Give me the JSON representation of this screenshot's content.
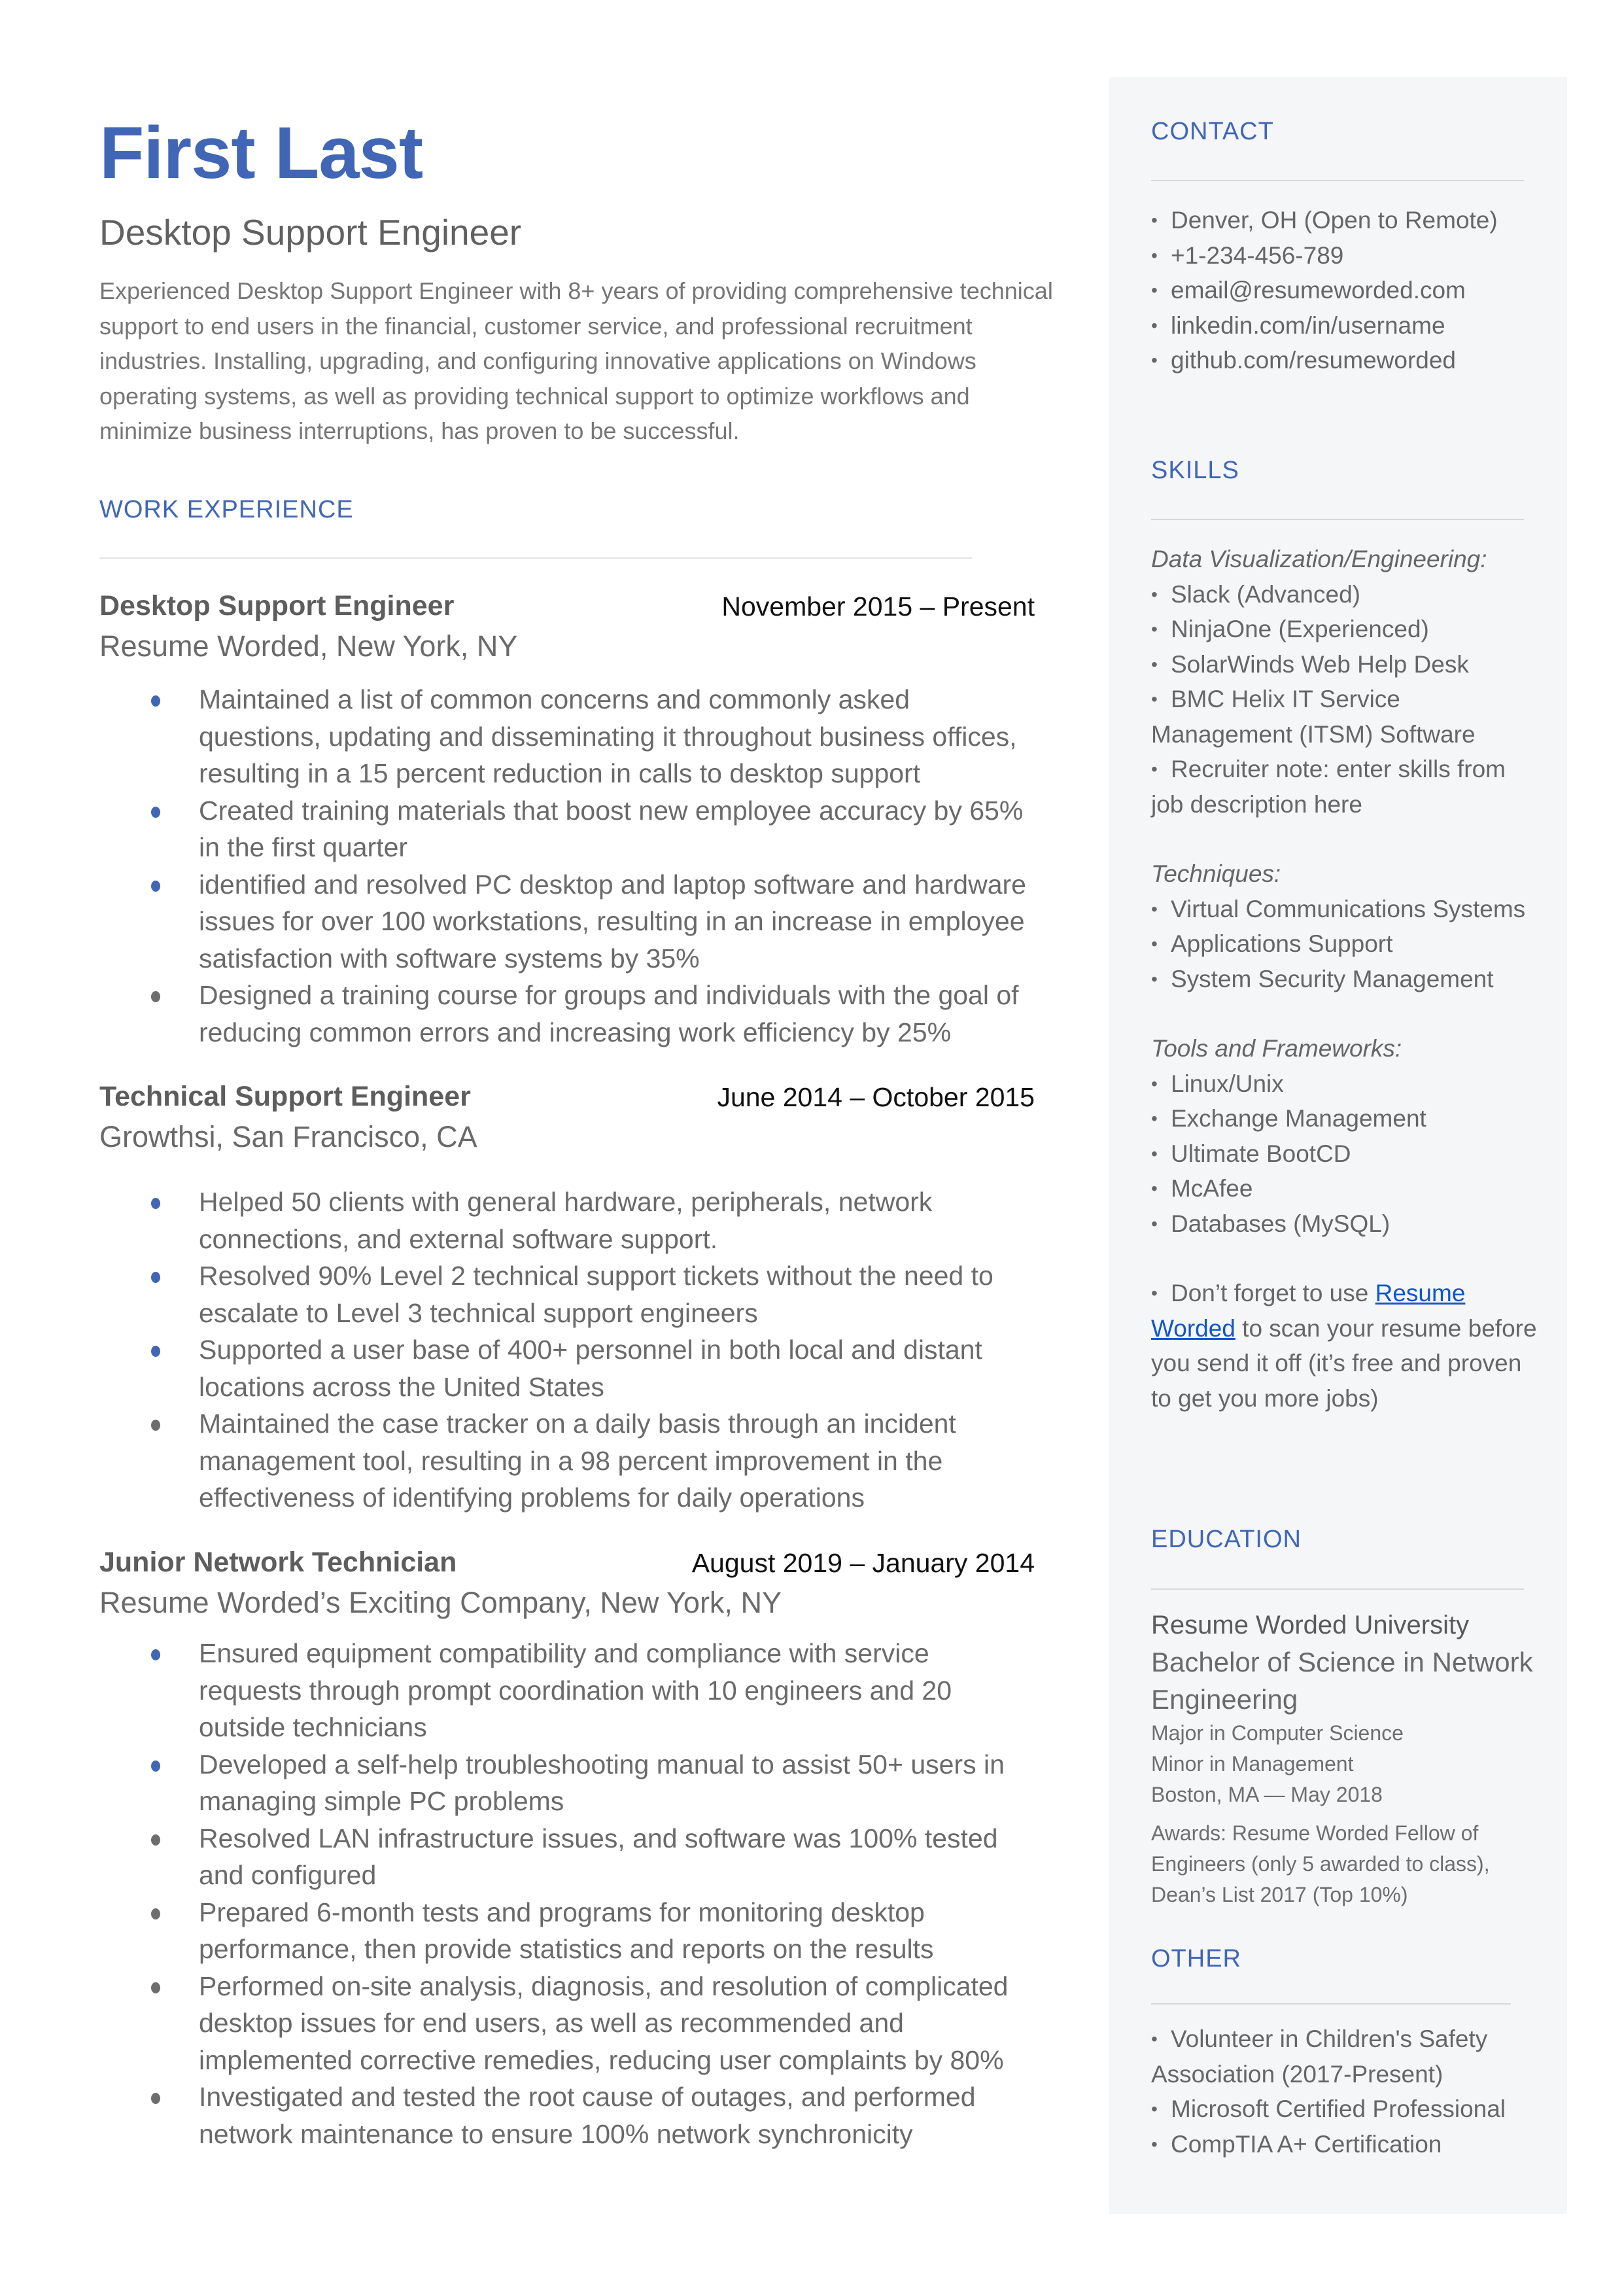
{
  "header": {
    "name": "First Last",
    "role": "Desktop Support Engineer",
    "summary_lines": [
      "Experienced Desktop Support Engineer with 8+ years of providing comprehensive technical",
      "support to end users in the financial, customer service, and professional recruitment",
      "industries. Installing, upgrading, and configuring innovative applications on Windows",
      "operating systems, as well as providing technical support to optimize workflows and",
      "minimize business interruptions, has proven to be successful."
    ]
  },
  "colors": {
    "accent": "#4166b5",
    "sidebar_bg": "#f5f6f8",
    "link": "#1155cc"
  },
  "work": {
    "heading": "WORK EXPERIENCE",
    "jobs": [
      {
        "title": "Desktop Support Engineer",
        "dates": "November 2015 – Present",
        "company": "Resume Worded, New York, NY",
        "bullets": [
          {
            "color": "blue",
            "lines": [
              "Maintained a list of common concerns and commonly asked",
              "questions, updating and disseminating it throughout business offices,",
              "resulting in a 15 percent reduction in calls to desktop support"
            ]
          },
          {
            "color": "blue",
            "lines": [
              "Created training materials that boost new employee accuracy by 65%",
              "in the first quarter"
            ]
          },
          {
            "color": "blue",
            "lines": [
              "identified and resolved PC desktop and laptop software and hardware",
              "issues for over 100 workstations, resulting in an increase in employee",
              "satisfaction with software systems by 35%"
            ]
          },
          {
            "color": "gray",
            "lines": [
              "Designed a training course for groups and individuals with the goal of",
              "reducing common errors and increasing work efficiency by 25%"
            ]
          }
        ]
      },
      {
        "title": "Technical Support Engineer",
        "dates": "June 2014 – October 2015",
        "company": "Growthsi, San Francisco, CA",
        "bullets": [
          {
            "color": "blue",
            "lines": [
              "Helped 50 clients with general hardware, peripherals, network",
              "connections, and external software support."
            ]
          },
          {
            "color": "blue",
            "lines": [
              "Resolved 90% Level 2 technical support tickets without the need to",
              "escalate to Level 3 technical support engineers"
            ]
          },
          {
            "color": "blue",
            "lines": [
              "Supported a user base of 400+ personnel in both local and distant",
              "locations across the United States"
            ]
          },
          {
            "color": "gray",
            "lines": [
              "Maintained the case tracker on a daily basis through an incident",
              "management tool, resulting in a 98 percent improvement in the",
              "effectiveness of identifying problems for daily operations"
            ]
          }
        ]
      },
      {
        "title": "Junior Network Technician",
        "dates": "August 2019 – January 2014",
        "company": "Resume Worded’s Exciting Company, New York, NY",
        "bullets": [
          {
            "color": "blue",
            "lines": [
              "Ensured equipment compatibility and compliance with service",
              "requests through prompt coordination with 10 engineers and 20",
              "outside technicians"
            ]
          },
          {
            "color": "blue",
            "lines": [
              "Developed a self-help troubleshooting manual to assist 50+ users in",
              "managing simple PC problems"
            ]
          },
          {
            "color": "gray",
            "lines": [
              "Resolved LAN infrastructure issues, and software was 100% tested",
              "and configured"
            ]
          },
          {
            "color": "gray",
            "lines": [
              "Prepared 6-month tests and programs for monitoring desktop",
              "performance, then provide statistics and reports on the results"
            ]
          },
          {
            "color": "gray",
            "lines": [
              "Performed on-site analysis, diagnosis, and resolution of complicated",
              "desktop issues for end users, as well as recommended and",
              "implemented corrective remedies, reducing user complaints by 80%"
            ]
          },
          {
            "color": "gray",
            "lines": [
              "Investigated and tested the root cause of outages, and performed",
              "network maintenance to ensure 100% network synchronicity"
            ]
          }
        ]
      }
    ]
  },
  "sidebar": {
    "contact": {
      "heading": "CONTACT",
      "items": [
        "Denver, OH (Open to Remote)",
        "+1-234-456-789",
        "email@resumeworded.com",
        "linkedin.com/in/username",
        "github.com/resumeworded"
      ]
    },
    "skills": {
      "heading": "SKILLS",
      "groups": [
        {
          "category": "Data Visualization/Engineering:",
          "items": [
            "Slack (Advanced)",
            "NinjaOne (Experienced)",
            "SolarWinds Web Help Desk",
            "BMC Helix IT Service Management (ITSM) Software",
            "Recruiter note: enter skills from job description here"
          ]
        },
        {
          "category": "Techniques:",
          "items": [
            "Virtual Communications Systems",
            "Applications Support",
            "System Security Management"
          ]
        },
        {
          "category": "Tools and Frameworks:",
          "items": [
            "Linux/Unix",
            "Exchange Management",
            "Ultimate BootCD",
            "McAfee",
            "Databases (MySQL)"
          ]
        }
      ],
      "tip_prefix": "Don’t forget to use ",
      "tip_link": "Resume Worded",
      "tip_suffix": " to scan your resume before you send it off (it’s free and proven to get you more jobs)"
    },
    "education": {
      "heading": "EDUCATION",
      "school": "Resume Worded University",
      "degree": "Bachelor of Science in Network Engineering",
      "major": "Major in Computer Science",
      "minor": "Minor in Management",
      "location_date": "Boston, MA — May 2018",
      "awards": "Awards: Resume Worded Fellow of Engineers (only 5 awarded to class), Dean’s List 2017 (Top 10%)"
    },
    "other": {
      "heading": "OTHER",
      "items": [
        "Volunteer in Children's Safety Association (2017-Present)",
        "Microsoft Certified Professional",
        "CompTIA A+ Certification"
      ]
    }
  }
}
